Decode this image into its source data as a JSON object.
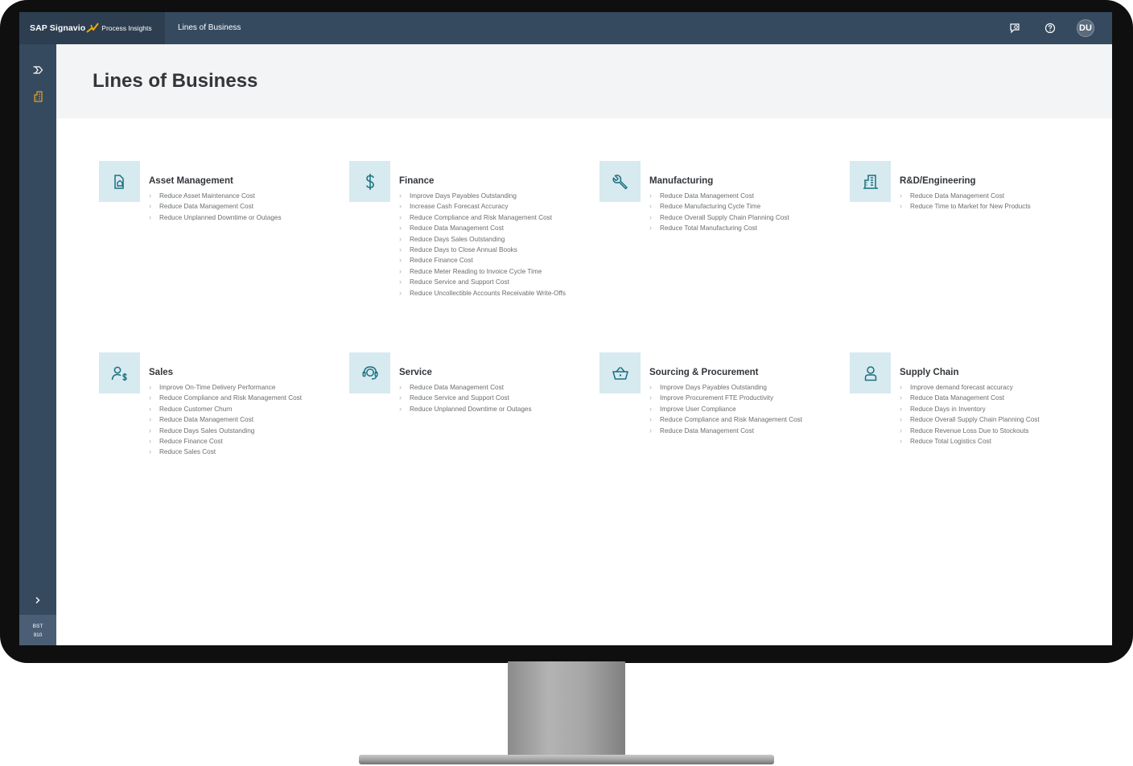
{
  "shellbar": {
    "brand_name": "SAP Signavio",
    "product": "Process Insights",
    "title": "Lines of Business",
    "user_initials": "DU",
    "icons": [
      "feedback-icon",
      "help-icon"
    ]
  },
  "sidenav": {
    "items": [
      {
        "icon": "collapse-nav-icon"
      },
      {
        "icon": "building-icon",
        "active": true
      }
    ],
    "expand_icon": "chevron-right-icon",
    "version_line1": "BST",
    "version_line2": "910"
  },
  "page": {
    "title": "Lines of Business"
  },
  "colors": {
    "shell": "#354a5f",
    "accent": "#e9a31f",
    "icon_tile": "#d6eaef",
    "icon_stroke": "#1c6f81"
  },
  "lines_of_business": [
    {
      "title": "Asset Management",
      "icon": "asset-management-icon",
      "items": [
        "Reduce Asset Maintenance Cost",
        "Reduce Data Management Cost",
        "Reduce Unplanned Downtime or Outages"
      ]
    },
    {
      "title": "Finance",
      "icon": "dollar-icon",
      "items": [
        "Improve Days Payables Outstanding",
        "Increase Cash Forecast Accuracy",
        "Reduce Compliance and Risk Management Cost",
        "Reduce Data Management Cost",
        "Reduce Days Sales Outstanding",
        "Reduce Days to Close Annual Books",
        "Reduce Finance Cost",
        "Reduce Meter Reading to Invoice Cycle Time",
        "Reduce Service and Support Cost",
        "Reduce Uncollectible Accounts Receivable Write-Offs"
      ]
    },
    {
      "title": "Manufacturing",
      "icon": "wrench-icon",
      "items": [
        "Reduce Data Management Cost",
        "Reduce Manufacturing Cycle Time",
        "Reduce Overall Supply Chain Planning Cost",
        "Reduce Total Manufacturing Cost"
      ]
    },
    {
      "title": "R&D/Engineering",
      "icon": "building-icon",
      "items": [
        "Reduce Data Management Cost",
        "Reduce Time to Market for New Products"
      ]
    },
    {
      "title": "Sales",
      "icon": "person-money-icon",
      "items": [
        "Improve On-Time Delivery Performance",
        "Reduce Compliance and Risk Management Cost",
        "Reduce Customer Churn",
        "Reduce Data Management Cost",
        "Reduce Days Sales Outstanding",
        "Reduce Finance Cost",
        "Reduce Sales Cost"
      ]
    },
    {
      "title": "Service",
      "icon": "headset-icon",
      "items": [
        "Reduce Data Management Cost",
        "Reduce Service and Support Cost",
        "Reduce Unplanned Downtime or Outages"
      ]
    },
    {
      "title": "Sourcing & Procurement",
      "icon": "basket-icon",
      "items": [
        "Improve Days Payables Outstanding",
        "Improve Procurement FTE Productivity",
        "Improve User Compliance",
        "Reduce Compliance and Risk Management Cost",
        "Reduce Data Management Cost"
      ]
    },
    {
      "title": "Supply Chain",
      "icon": "person-icon",
      "items": [
        "Improve demand forecast accuracy",
        "Reduce Data Management Cost",
        "Reduce Days in Inventory",
        "Reduce Overall Supply Chain Planning Cost",
        "Reduce Revenue Loss Due to Stockouts",
        "Reduce Total Logistics Cost"
      ]
    }
  ]
}
